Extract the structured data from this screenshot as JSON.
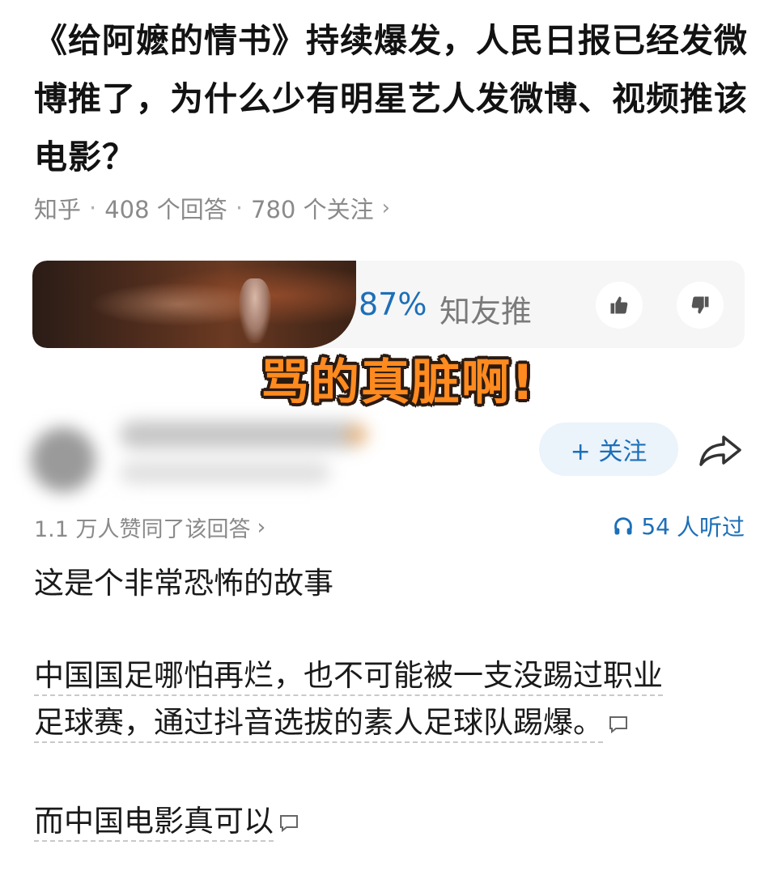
{
  "question": {
    "title": "《给阿嬷的情书》持续爆发，人民日报已经发微博推了，为什么少有明星艺人发微博、视频推该电影？"
  },
  "meta": {
    "source": "知乎",
    "separator": "·",
    "answers": "408 个回答",
    "followers": "780 个关注",
    "chevron": "›"
  },
  "recommend": {
    "percent": "87%",
    "label": "知友推",
    "like_icon": "thumbs-up-icon",
    "dislike_icon": "thumbs-down-icon"
  },
  "sticker": {
    "text": "骂的真脏啊!",
    "color": "#ff8a1f"
  },
  "author": {
    "follow_label": "+ 关注",
    "share_icon": "share-arrow-icon"
  },
  "stats": {
    "agree_text": "1.1 万人赞同了该回答",
    "agree_chevron": "›",
    "listen_icon": "headphones-icon",
    "listen_count": "54",
    "listen_text": "人听过"
  },
  "answer": {
    "p1": "这是个非常恐怖的故事",
    "p2_line1": "中国国足哪怕再烂，也不可能被一支没踢过职业",
    "p2_line2": "足球赛，通过抖音选拔的素人足球队踢爆。",
    "p3": "而中国电影真可以"
  },
  "colors": {
    "accent": "#1c6fb8",
    "muted": "#8a8a8a"
  }
}
